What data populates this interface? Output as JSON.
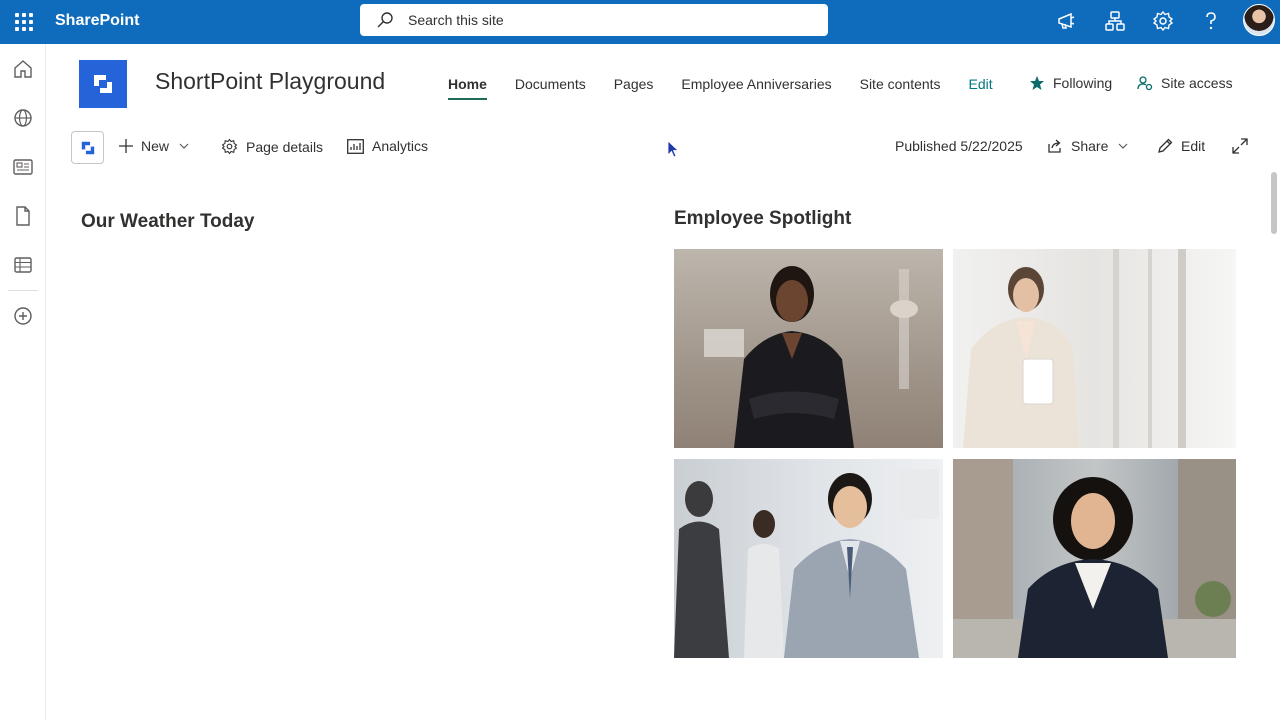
{
  "suite": {
    "app_name": "SharePoint",
    "search_placeholder": "Search this site"
  },
  "site": {
    "title": "ShortPoint Playground",
    "nav": [
      {
        "label": "Home",
        "active": true
      },
      {
        "label": "Documents"
      },
      {
        "label": "Pages"
      },
      {
        "label": "Employee Anniversaries"
      },
      {
        "label": "Site contents"
      }
    ],
    "nav_edit": "Edit",
    "following": "Following",
    "site_access": "Site access"
  },
  "command_bar": {
    "new": "New",
    "page_details": "Page details",
    "analytics": "Analytics",
    "published": "Published 5/22/2025",
    "share": "Share",
    "edit": "Edit"
  },
  "sections": {
    "weather_title": "Our Weather Today",
    "spotlight_title": "Employee Spotlight"
  },
  "icons": {
    "waffle": "app-launcher-icon",
    "search": "search-icon",
    "megaphone": "megaphone-icon",
    "org": "org-chart-icon",
    "settings": "gear-icon",
    "help": "help-icon"
  },
  "colors": {
    "suite_bar": "#0f6cbd",
    "accent": "#03787c",
    "site_logo": "#2563d9"
  }
}
